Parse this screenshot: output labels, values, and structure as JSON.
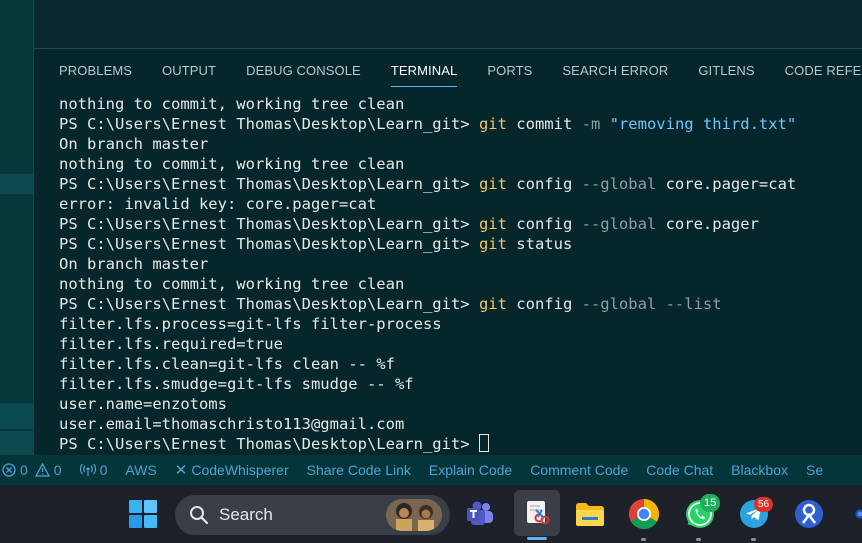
{
  "panel": {
    "tabs": [
      {
        "label": "PROBLEMS"
      },
      {
        "label": "OUTPUT"
      },
      {
        "label": "DEBUG CONSOLE"
      },
      {
        "label": "TERMINAL"
      },
      {
        "label": "PORTS"
      },
      {
        "label": "SEARCH ERROR"
      },
      {
        "label": "GITLENS"
      },
      {
        "label": "CODE REFERENCE L"
      }
    ],
    "active_tab": "TERMINAL"
  },
  "terminal": {
    "prompt": "PS C:\\Users\\Ernest Thomas\\Desktop\\Learn_git> ",
    "lines": [
      "nothing to commit, working tree clean",
      {
        "cmd": "git",
        "rest_before": "commit ",
        "flag": "-m",
        "str": "\"removing third.txt\""
      },
      "On branch master",
      "nothing to commit, working tree clean",
      {
        "cmd": "git",
        "rest_before": "config ",
        "flag": "--global",
        "rest_after": " core.pager=cat"
      },
      "error: invalid key: core.pager=cat",
      {
        "cmd": "git",
        "rest_before": "config ",
        "flag": "--global",
        "rest_after": " core.pager"
      },
      {
        "cmd": "git",
        "rest_before": "status"
      },
      "On branch master",
      "nothing to commit, working tree clean",
      {
        "cmd": "git",
        "rest_before": "config ",
        "flag": "--global --list"
      },
      "filter.lfs.process=git-lfs filter-process",
      "filter.lfs.required=true",
      "filter.lfs.clean=git-lfs clean -- %f",
      "filter.lfs.smudge=git-lfs smudge -- %f",
      "user.name=enzotoms",
      "user.email=thomaschristo113@gmail.com",
      {
        "prompt_only": true
      }
    ]
  },
  "status_bar": {
    "errors": "0",
    "warnings": "0",
    "ports": "0",
    "aws": "AWS",
    "codewhisperer": "CodeWhisperer",
    "share_code_link": "Share Code Link",
    "explain_code": "Explain Code",
    "comment_code": "Comment Code",
    "code_chat": "Code Chat",
    "blackbox": "Blackbox",
    "overflow": "Se"
  },
  "taskbar": {
    "search_label": "Search",
    "whatsapp_badge": "15",
    "telegram_badge": "56"
  },
  "colors": {
    "terminal_bg": "#05272b",
    "command": "#f3c66a",
    "flag": "#8f9fa1",
    "string": "#6ec6ff",
    "status_text": "#4fa3d6",
    "taskbar_bg": "#1d2129"
  }
}
